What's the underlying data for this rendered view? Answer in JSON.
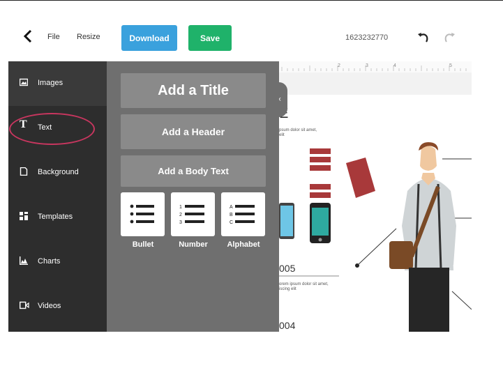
{
  "toolbar": {
    "file_label": "File",
    "resize_label": "Resize",
    "download_label": "Download",
    "save_label": "Save",
    "doc_id": "1623232770",
    "download_color": "#3aa1dd",
    "save_color": "#1fb26a"
  },
  "sidebar": {
    "items": [
      {
        "label": "Images",
        "icon": "image-icon"
      },
      {
        "label": "Text",
        "icon": "text-icon"
      },
      {
        "label": "Background",
        "icon": "background-icon"
      },
      {
        "label": "Templates",
        "icon": "templates-icon"
      },
      {
        "label": "Charts",
        "icon": "chart-icon"
      },
      {
        "label": "Videos",
        "icon": "video-icon"
      }
    ],
    "highlight_color": "#c8365f"
  },
  "text_panel": {
    "title_btn": "Add a Title",
    "header_btn": "Add a Header",
    "body_btn": "Add a Body Text",
    "list_labels": [
      "Bullet",
      "Number",
      "Alphabet"
    ]
  },
  "canvas": {
    "ruler_labels": [
      "2",
      "3",
      "4",
      "5"
    ],
    "heading_fragment": "E",
    "lorem_1": "psum dolor sit amet,",
    "lorem_1b": "elit",
    "year_1": "005",
    "lorem_2": "orem ipsum dolor sit amet,",
    "lorem_2b": "iscing elit",
    "year_2": "004"
  }
}
